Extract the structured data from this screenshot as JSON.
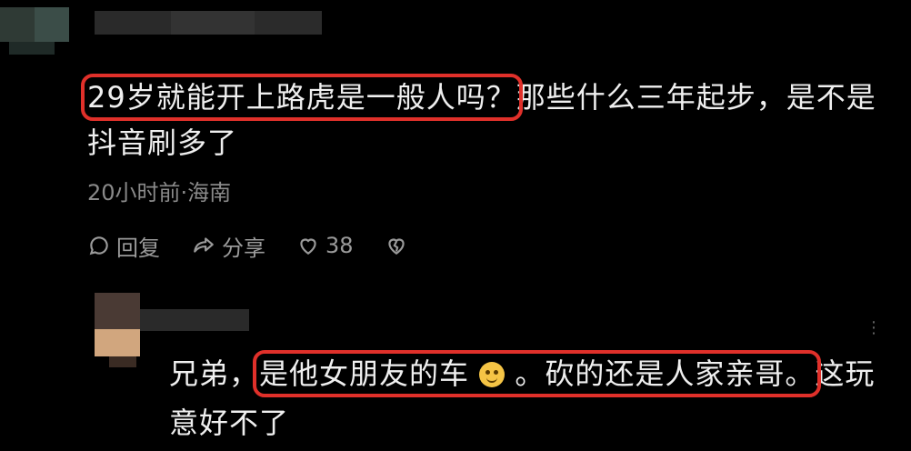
{
  "comment": {
    "text_highlighted": "29岁就能开上路虎是一般人吗？",
    "text_rest": "那些什么三年起步，是不是抖音刷多了",
    "meta": "20小时前·海南",
    "actions": {
      "reply_label": "回复",
      "share_label": "分享",
      "like_count": "38"
    }
  },
  "reply": {
    "prefix": "兄弟，",
    "highlight_part1": "是他女朋友的车",
    "highlight_part2": "。砍的还是人家亲哥。",
    "suffix": "这玩意好不了"
  },
  "colors": {
    "background": "#000000",
    "highlight_border": "#e0302a",
    "text": "#efefef",
    "meta": "#8a8a8a"
  }
}
